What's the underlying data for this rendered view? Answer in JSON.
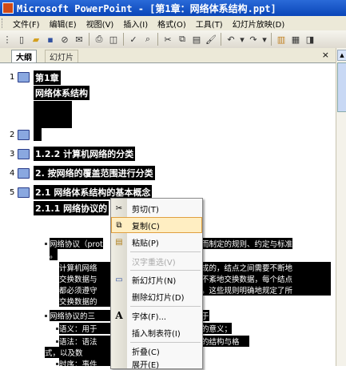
{
  "window": {
    "title": "Microsoft PowerPoint - [第1章：网络体系结构.ppt]"
  },
  "menu": [
    "文件(F)",
    "编辑(E)",
    "视图(V)",
    "插入(I)",
    "格式(O)",
    "工具(T)",
    "幻灯片放映(D)"
  ],
  "toolbar": {
    "icons": [
      "new-icon",
      "open-icon",
      "save-icon",
      "permission-icon",
      "email-icon",
      "print-icon",
      "print-preview-icon",
      "spelling-icon",
      "research-icon",
      "cut-icon",
      "copy-icon",
      "paste-icon",
      "format-painter-icon",
      "undo-icon",
      "redo-icon",
      "chart-icon",
      "table-icon",
      "tables-borders-icon"
    ]
  },
  "pane": {
    "tabs": [
      "大纲",
      "幻灯片"
    ],
    "close": "×"
  },
  "outline": {
    "slides": [
      {
        "num": "1",
        "lines": [
          "第1章",
          "网络体系结构"
        ]
      },
      {
        "num": "2",
        "lines": []
      },
      {
        "num": "3",
        "lines": [
          "1.2.2 计算机网络的分类"
        ]
      },
      {
        "num": "4",
        "lines": [
          "2. 按网络的覆盖范围进行分类"
        ]
      },
      {
        "num": "5",
        "lines": [
          "2.1  网络体系结构的基本概念",
          "2.1.1  网络协议的"
        ]
      }
    ],
    "body": [
      "网络协议（prot",
      "而制定的规则、约定与标准",
      "。",
      "计算机网络",
      "成的，结点之间需要不断地",
      "交换数据与",
      "不紊地交换数据，每个结点",
      "都必须遵守",
      "。这些规则明确地规定了所",
      "交换数据的",
      "网络协议的三",
      "于",
      "语义：用于",
      "的意义；",
      "语法：语法",
      "的结构与格",
      "式，以及数",
      "时序：事件"
    ]
  },
  "context_menu": {
    "items": [
      {
        "label": "剪切(T)",
        "icon": "cut-icon",
        "disabled": false
      },
      {
        "label": "复制(C)",
        "icon": "copy-icon",
        "disabled": false,
        "selected": true
      },
      {
        "label": "粘贴(P)",
        "icon": "paste-icon",
        "disabled": false
      },
      {
        "label": "汉字重选(V)",
        "icon": "",
        "disabled": true
      },
      {
        "label": "新幻灯片(N)",
        "icon": "new-slide-icon",
        "disabled": false
      },
      {
        "label": "删除幻灯片(D)",
        "icon": "",
        "disabled": false
      },
      {
        "label": "字体(F)...",
        "icon": "font-icon",
        "disabled": false
      },
      {
        "label": "插入制表符(I)",
        "icon": "",
        "disabled": false
      },
      {
        "label": "折叠(C)",
        "icon": "",
        "disabled": false
      },
      {
        "label": "展开(E)",
        "icon": "",
        "disabled": false
      }
    ]
  }
}
